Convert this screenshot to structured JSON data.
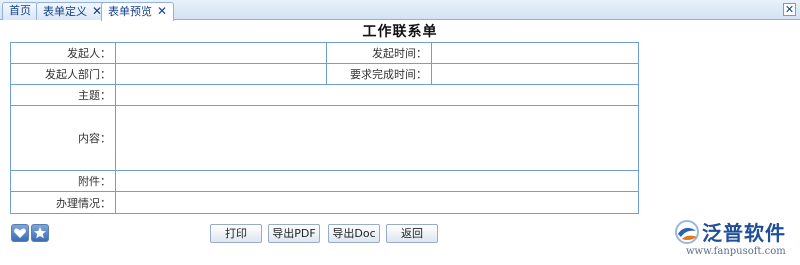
{
  "tabs": [
    {
      "label": "首页",
      "closable": false
    },
    {
      "label": "表单定义",
      "closable": true
    },
    {
      "label": "表单预览",
      "closable": true,
      "active": true
    }
  ],
  "tab_close_glyph": "✕",
  "window_close_glyph": "✕",
  "form": {
    "title": "工作联系单",
    "fields": {
      "initiator": "发起人：",
      "initiate_time": "发起时间：",
      "initiator_dept": "发起人部门：",
      "required_finish_time": "要求完成时间：",
      "subject": "主题：",
      "content": "内容：",
      "attachment": "附件：",
      "handling": "办理情况："
    }
  },
  "buttons": {
    "print": "打印",
    "export_pdf": "导出PDF",
    "export_doc": "导出Doc",
    "back": "返回"
  },
  "side_icons": [
    "heart-icon",
    "star-icon"
  ],
  "brand": {
    "name": "泛普软件",
    "url": "www.fanpusoft.com"
  },
  "colors": {
    "accent": "#15428b",
    "border": "#6f9fd8",
    "brand": "#1f4f9a"
  }
}
